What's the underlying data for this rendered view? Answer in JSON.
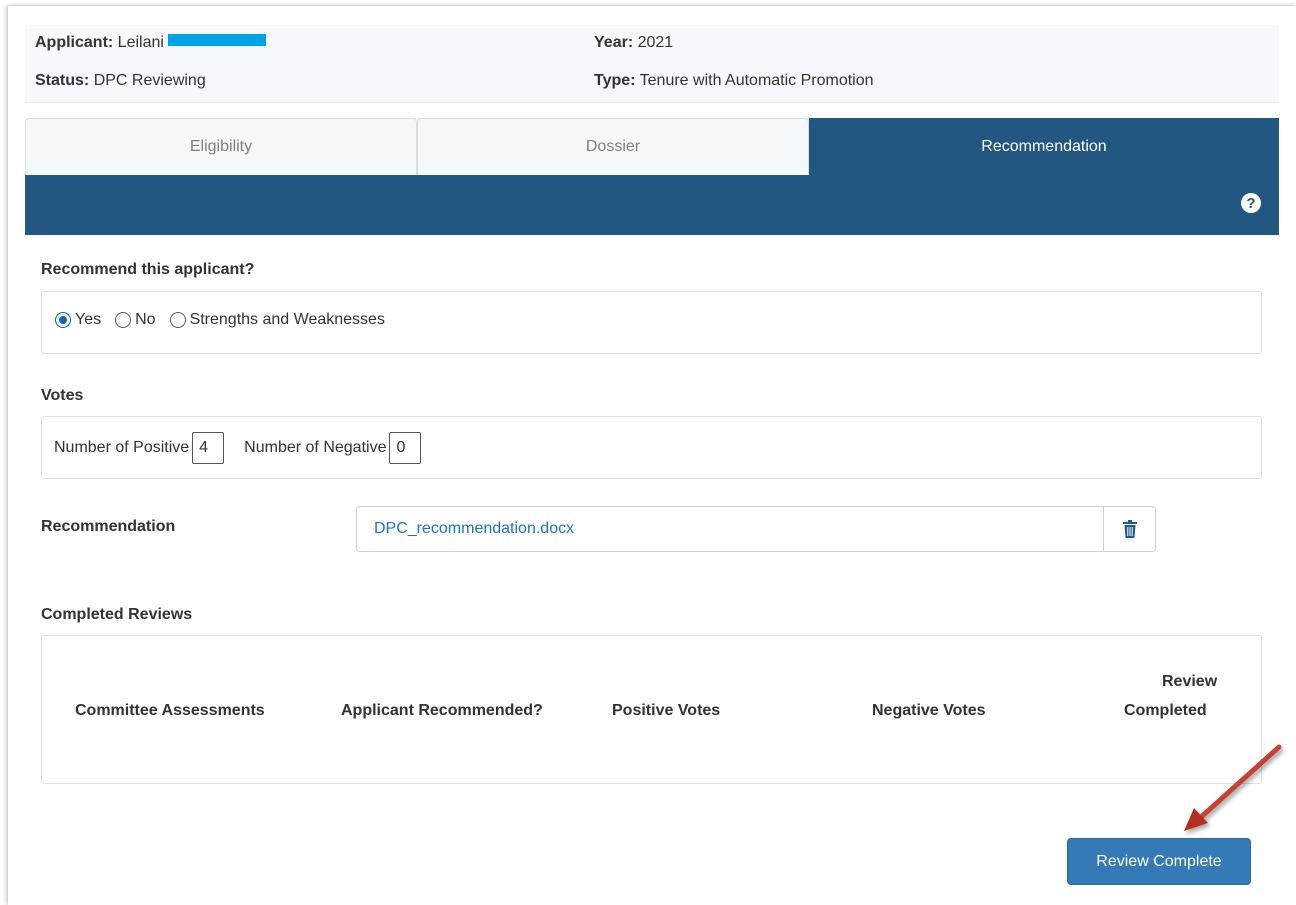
{
  "header": {
    "applicant_label": "Applicant:",
    "applicant_value": "Leilani",
    "status_label": "Status:",
    "status_value": "DPC Reviewing",
    "year_label": "Year:",
    "year_value": "2021",
    "type_label": "Type:",
    "type_value": "Tenure with Automatic Promotion"
  },
  "tabs": [
    {
      "label": "Eligibility",
      "active": false
    },
    {
      "label": "Dossier",
      "active": false
    },
    {
      "label": "Recommendation",
      "active": true
    }
  ],
  "help_icon": "question-circle-icon",
  "recommend": {
    "label": "Recommend this applicant?",
    "options": [
      "Yes",
      "No",
      "Strengths and Weaknesses"
    ],
    "selected": "Yes"
  },
  "votes": {
    "label": "Votes",
    "positive_label": "Number of Positive",
    "positive_value": "4",
    "negative_label": "Number of Negative",
    "negative_value": "0"
  },
  "recommendation": {
    "label": "Recommendation",
    "file_name": "DPC_recommendation.docx",
    "delete_icon": "trash-icon"
  },
  "completed_reviews": {
    "label": "Completed Reviews",
    "columns": [
      "Committee Assessments",
      "Applicant Recommended?",
      "Positive Votes",
      "Negative Votes",
      "Review",
      "Completed"
    ]
  },
  "submit": {
    "label": "Review Complete"
  },
  "colors": {
    "primary": "#215781",
    "button": "#337ab7",
    "link": "#1a73c9",
    "redaction": "#00a3e8",
    "annotation_arrow": "#c0392b"
  }
}
